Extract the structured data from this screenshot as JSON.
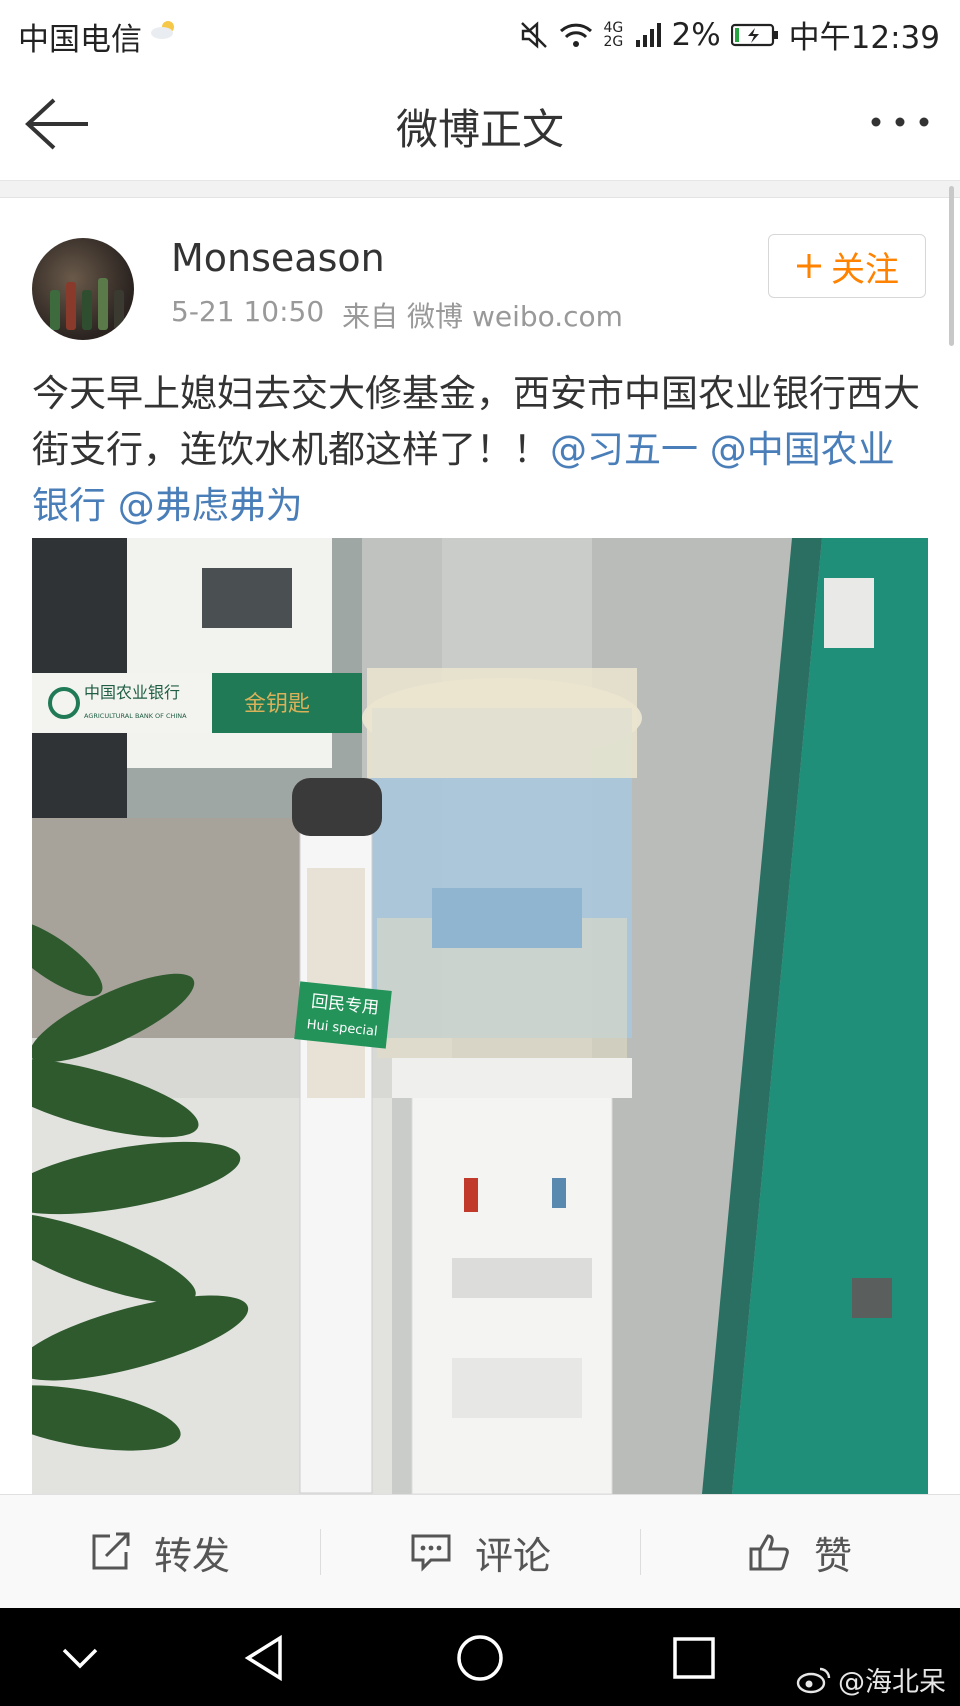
{
  "status_bar": {
    "carrier": "中国电信",
    "network": "4G 2G",
    "battery_percent": "2%",
    "time": "中午12:39"
  },
  "nav": {
    "title": "微博正文"
  },
  "post": {
    "author": "Monseason",
    "time": "5-21 10:50",
    "source": "来自 微博 weibo.com",
    "follow_label": "关注",
    "text_plain": "今天早上媳妇去交大修基金，西安市中国农业银行西大街支行，连饮水机都这样了！！",
    "mentions": [
      "@习五一",
      "@中国农业银行",
      "@弗虑弗为"
    ],
    "photo_texts": {
      "bank_sign_cn": "中国农业银行",
      "bank_sign_en": "AGRICULTURAL BANK OF CHINA",
      "gold_sign": "金钥匙",
      "cup_label_cn": "回民专用",
      "cup_label_en": "Hui special"
    }
  },
  "actions": {
    "repost": "转发",
    "comment": "评论",
    "like": "赞"
  },
  "watermark": "@海北呆"
}
